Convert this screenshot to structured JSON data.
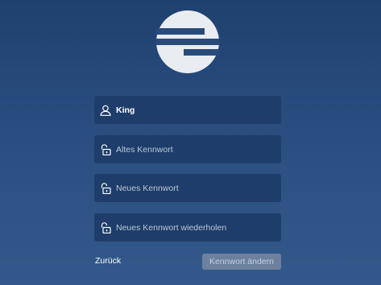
{
  "form": {
    "username": {
      "value": "King",
      "icon": "user-icon"
    },
    "old_password": {
      "placeholder": "Altes Kennwort",
      "icon": "lock-icon"
    },
    "new_password": {
      "placeholder": "Neues Kennwort",
      "icon": "lock-icon"
    },
    "repeat_password": {
      "placeholder": "Neues Kennwort wiederholen",
      "icon": "lock-icon"
    }
  },
  "actions": {
    "back_label": "Zurück",
    "submit_label": "Kennwort ändern"
  },
  "colors": {
    "background_top": "#1f4170",
    "background_bottom": "#33598a",
    "field_background": "#1f3d6a",
    "button_disabled": "#6d819e"
  }
}
